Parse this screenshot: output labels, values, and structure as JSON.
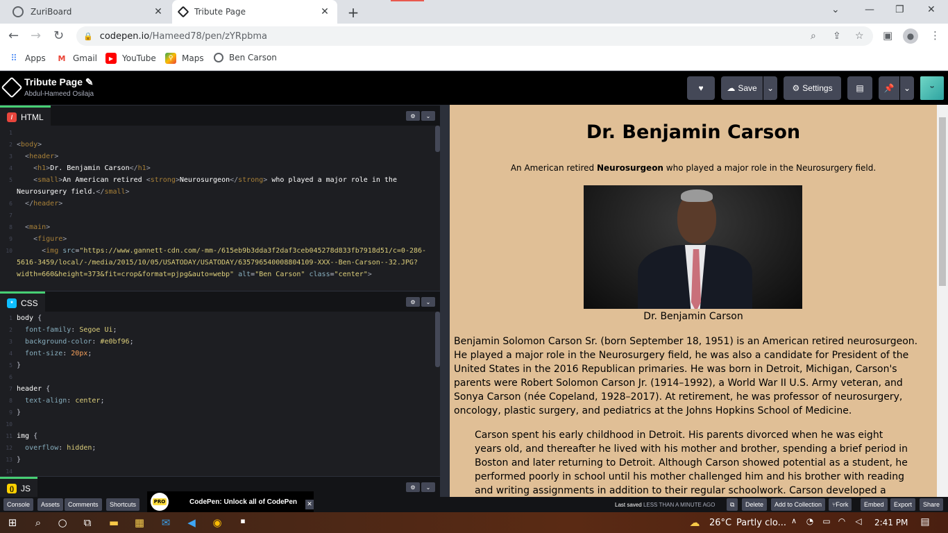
{
  "browser": {
    "tabs": [
      {
        "title": "ZuriBoard"
      },
      {
        "title": "Tribute Page"
      }
    ],
    "url_host": "codepen.io",
    "url_path": "/Hameed78/pen/zYRpbma",
    "bookmarks": [
      {
        "label": "Apps"
      },
      {
        "label": "Gmail"
      },
      {
        "label": "YouTube"
      },
      {
        "label": "Maps"
      },
      {
        "label": "Ben Carson"
      }
    ]
  },
  "codepen": {
    "title": "Tribute Page",
    "author": "Abdul-Hameed Osilaja",
    "buttons": {
      "save": "Save",
      "settings": "Settings"
    },
    "panels": {
      "html": "HTML",
      "css": "CSS",
      "js": "JS"
    }
  },
  "html_code": [
    {
      "n": "1"
    },
    {
      "n": "2"
    },
    {
      "n": "3"
    },
    {
      "n": "4"
    },
    {
      "n": "5"
    },
    {
      "n": "6"
    },
    {
      "n": "7"
    },
    {
      "n": "8"
    },
    {
      "n": "9"
    },
    {
      "n": "10"
    }
  ],
  "css_code": [
    {
      "n": "1"
    },
    {
      "n": "2"
    },
    {
      "n": "3"
    },
    {
      "n": "4"
    },
    {
      "n": "5"
    },
    {
      "n": "6"
    },
    {
      "n": "7"
    },
    {
      "n": "8"
    },
    {
      "n": "9"
    },
    {
      "n": "10"
    },
    {
      "n": "11"
    },
    {
      "n": "12"
    },
    {
      "n": "13"
    },
    {
      "n": "14"
    }
  ],
  "preview": {
    "heading": "Dr. Benjamin Carson",
    "subtitle_pre": "An American retired ",
    "subtitle_strong": "Neurosurgeon",
    "subtitle_post": " who played a major role in the Neurosurgery field.",
    "figcaption": "Dr. Benjamin Carson",
    "paragraph1": "Benjamin Solomon Carson Sr. (born September 18, 1951) is an American retired neurosurgeon. He played a major role in the Neurosurgery field, he was also a candidate for President of the United States in the 2016 Republican primaries. He was born in Detroit, Michigan, Carson's parents were Robert Solomon Carson Jr. (1914–1992), a World War II U.S. Army veteran, and Sonya Carson (née Copeland, 1928–2017). At retirement, he was professor of neurosurgery, oncology, plastic surgery, and pediatrics at the Johns Hopkins School of Medicine.",
    "paragraph2": "Carson spent his early childhood in Detroit. His parents divorced when he was eight years old, and thereafter he lived with his mother and brother, spending a brief period in Boston and later returning to Detroit. Although Carson showed potential as a student, he performed poorly in school until his mother challenged him and his brother with reading and writing assignments in addition to their regular schoolwork. Carson developed a newfound interest in",
    "background_color": "#e0bf96"
  },
  "footer": {
    "buttons": [
      "Console",
      "Assets",
      "Comments",
      "Shortcuts"
    ],
    "promo_badge": "PRO",
    "promo_text": "CodePen: Unlock all of CodePen",
    "saved_label": "Last saved",
    "saved_time": "LESS THAN A MINUTE AGO",
    "right_buttons": [
      "Delete",
      "Add to Collection",
      "Fork",
      "Embed",
      "Export",
      "Share"
    ]
  },
  "taskbar": {
    "temperature": "26°C",
    "weather": "Partly clo...",
    "time": "2:41 PM"
  },
  "colors": {
    "accent": "#47cf73",
    "preview_bg": "#e0bf96"
  }
}
